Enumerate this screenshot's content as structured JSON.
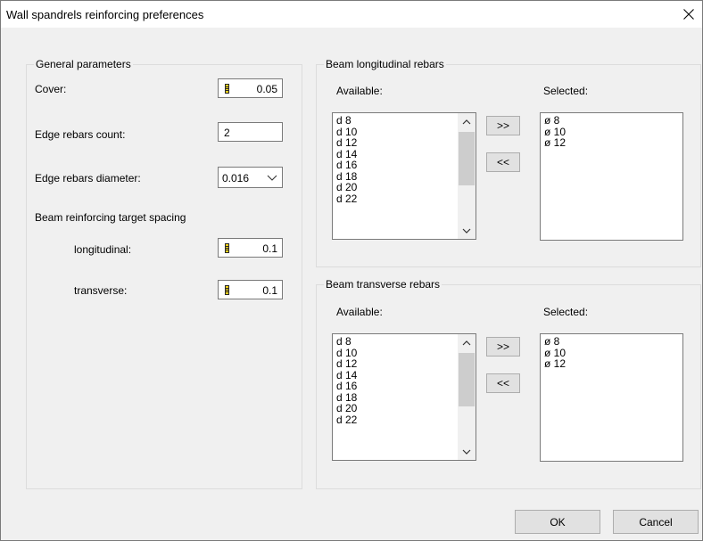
{
  "window": {
    "title": "Wall spandrels reinforcing preferences"
  },
  "general": {
    "label": "General parameters",
    "cover_label": "Cover:",
    "cover_value": "0.05",
    "edge_count_label": "Edge rebars count:",
    "edge_count_value": "2",
    "edge_diameter_label": "Edge rebars diameter:",
    "edge_diameter_value": "0.016",
    "spacing_label": "Beam reinforcing target spacing",
    "longitudinal_label": "longitudinal:",
    "longitudinal_value": "0.1",
    "transverse_label": "transverse:",
    "transverse_value": "0.1"
  },
  "longitudinal_rebars": {
    "label": "Beam longitudinal rebars",
    "available_label": "Available:",
    "selected_label": "Selected:",
    "available": [
      "d 8",
      "d 10",
      "d 12",
      "d 14",
      "d 16",
      "d 18",
      "d 20",
      "d 22"
    ],
    "selected": [
      "ø 8",
      "ø 10",
      "ø 12"
    ],
    "add_label": ">>",
    "remove_label": "<<"
  },
  "transverse_rebars": {
    "label": "Beam transverse rebars",
    "available_label": "Available:",
    "selected_label": "Selected:",
    "available": [
      "d 8",
      "d 10",
      "d 12",
      "d 14",
      "d 16",
      "d 18",
      "d 20",
      "d 22"
    ],
    "selected": [
      "ø 8",
      "ø 10",
      "ø 12"
    ],
    "add_label": ">>",
    "remove_label": "<<"
  },
  "footer": {
    "ok_label": "OK",
    "cancel_label": "Cancel"
  },
  "icons": {
    "close": "close-icon",
    "calculator": "calculator-icon",
    "dropdown": "chevron-down-icon",
    "scroll_up": "chevron-up-icon",
    "scroll_down": "chevron-down-icon"
  }
}
